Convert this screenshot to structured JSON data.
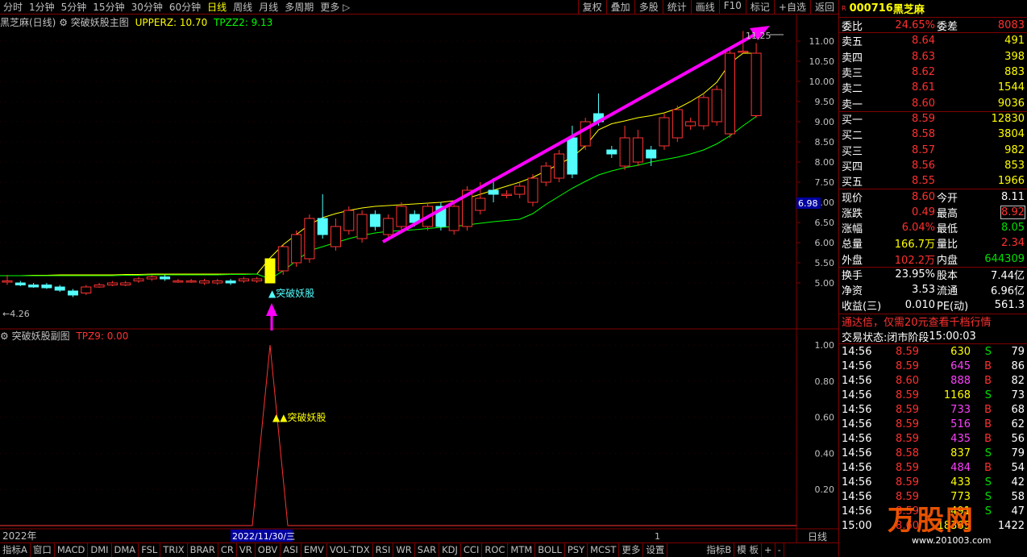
{
  "topbar": {
    "periods": [
      "分时",
      "1分钟",
      "5分钟",
      "15分钟",
      "30分钟",
      "60分钟",
      "日线",
      "周线",
      "月线",
      "多周期",
      "更多 ▷"
    ],
    "active_period": "日线",
    "tools": [
      "复权",
      "叠加",
      "多股",
      "统计",
      "画线",
      "F10",
      "标记",
      "+自选",
      "返回"
    ]
  },
  "main_chart": {
    "stock_label": "黑芝麻(日线)",
    "indicator_name": "突破妖股主图",
    "upperz_label": "UPPERZ: 10.70",
    "tpzz2_label": "TPZZ2: 9.13",
    "high_marker": "11.25",
    "low_marker": "4.26",
    "signal_label": "▲突破妖股",
    "price_tag": "6.98",
    "y_ticks": [
      "11.00",
      "10.50",
      "10.00",
      "9.50",
      "9.00",
      "8.50",
      "8.00",
      "7.50",
      "7.00",
      "6.50",
      "6.00",
      "5.50",
      "5.00"
    ]
  },
  "sub_chart": {
    "indicator_name": "突破妖股副图",
    "tpz9_label": "TPZ9: 0.00",
    "signal_label": "▲▲突破妖股",
    "y_ticks": [
      "1.00",
      "0.80",
      "0.60",
      "0.40",
      "0.20"
    ]
  },
  "x_axis": {
    "year_label": "2022年",
    "cursor_date": "2022/11/30/三",
    "marker": "1",
    "period_label": "日线"
  },
  "bottombar": {
    "items": [
      "指标A",
      "窗口",
      "MACD",
      "DMI",
      "DMA",
      "FSL",
      "TRIX",
      "BRAR",
      "CR",
      "VR",
      "OBV",
      "ASI",
      "EMV",
      "VOL-TDX",
      "RSI",
      "WR",
      "SAR",
      "KDJ",
      "CCI",
      "ROC",
      "MTM",
      "BOLL",
      "PSY",
      "MCST",
      "更多",
      "设置",
      "指标B",
      "模 板",
      "+",
      "-"
    ]
  },
  "quote": {
    "badge": "R",
    "code": "000716",
    "name": "黑芝麻",
    "weibi_label": "委比",
    "weibi": "24.65%",
    "weicha_label": "委差",
    "weicha": "8083",
    "sells": [
      {
        "label": "卖五",
        "price": "8.64",
        "vol": "491"
      },
      {
        "label": "卖四",
        "price": "8.63",
        "vol": "398"
      },
      {
        "label": "卖三",
        "price": "8.62",
        "vol": "883"
      },
      {
        "label": "卖二",
        "price": "8.61",
        "vol": "1544"
      },
      {
        "label": "卖一",
        "price": "8.60",
        "vol": "9036"
      }
    ],
    "buys": [
      {
        "label": "买一",
        "price": "8.59",
        "vol": "12830"
      },
      {
        "label": "买二",
        "price": "8.58",
        "vol": "3804"
      },
      {
        "label": "买三",
        "price": "8.57",
        "vol": "982"
      },
      {
        "label": "买四",
        "price": "8.56",
        "vol": "853"
      },
      {
        "label": "买五",
        "price": "8.55",
        "vol": "1966"
      }
    ],
    "stats": [
      {
        "l1": "现价",
        "v1": "8.60",
        "l2": "今开",
        "v2": "8.11"
      },
      {
        "l1": "涨跌",
        "v1": "0.49",
        "l2": "最高",
        "v2": "8.92"
      },
      {
        "l1": "涨幅",
        "v1": "6.04%",
        "l2": "最低",
        "v2": "8.05"
      },
      {
        "l1": "总量",
        "v1": "166.7万",
        "l2": "量比",
        "v2": "2.34"
      },
      {
        "l1": "外盘",
        "v1": "102.2万",
        "l2": "内盘",
        "v2": "644309"
      }
    ],
    "stats2": [
      {
        "l1": "换手",
        "v1": "23.95%",
        "l2": "股本",
        "v2": "7.44亿"
      },
      {
        "l1": "净资",
        "v1": "3.53",
        "l2": "流通",
        "v2": "6.96亿"
      },
      {
        "l1": "收益(三)",
        "v1": "0.010",
        "l2": "PE(动)",
        "v2": "561.3"
      }
    ],
    "ad_text": "通达信，仅需20元查看千档行情",
    "trade_status_label": "交易状态:",
    "trade_status": "闭市阶段",
    "trade_time": "15:00:03",
    "ticks": [
      {
        "t": "14:56",
        "p": "8.59",
        "v": "630",
        "s": "S",
        "n": "79"
      },
      {
        "t": "14:56",
        "p": "8.59",
        "v": "645",
        "s": "B",
        "n": "86"
      },
      {
        "t": "14:56",
        "p": "8.60",
        "v": "888",
        "s": "B",
        "n": "82"
      },
      {
        "t": "14:56",
        "p": "8.59",
        "v": "1168",
        "s": "S",
        "n": "73"
      },
      {
        "t": "14:56",
        "p": "8.59",
        "v": "733",
        "s": "B",
        "n": "68"
      },
      {
        "t": "14:56",
        "p": "8.59",
        "v": "516",
        "s": "B",
        "n": "62"
      },
      {
        "t": "14:56",
        "p": "8.59",
        "v": "435",
        "s": "B",
        "n": "56"
      },
      {
        "t": "14:56",
        "p": "8.58",
        "v": "837",
        "s": "S",
        "n": "79"
      },
      {
        "t": "14:56",
        "p": "8.59",
        "v": "484",
        "s": "B",
        "n": "54"
      },
      {
        "t": "14:56",
        "p": "8.59",
        "v": "433",
        "s": "S",
        "n": "42"
      },
      {
        "t": "14:56",
        "p": "8.59",
        "v": "773",
        "s": "S",
        "n": "58"
      },
      {
        "t": "14:56",
        "p": "8.59",
        "v": "491",
        "s": "S",
        "n": "47"
      },
      {
        "t": "15:00",
        "p": "8.60",
        "v": "18365",
        "s": "",
        "n": "1422"
      }
    ],
    "watermark": "万股网",
    "watermark_url": "www.201003.com"
  },
  "chart_data": {
    "type": "candlestick",
    "candles": [
      [
        5.05,
        5.05,
        5.2,
        4.95
      ],
      [
        5.0,
        4.95,
        5.05,
        4.92
      ],
      [
        4.95,
        4.9,
        5.0,
        4.88
      ],
      [
        4.95,
        4.88,
        5.0,
        4.85
      ],
      [
        4.9,
        4.82,
        4.95,
        4.78
      ],
      [
        4.8,
        4.7,
        4.85,
        4.65
      ],
      [
        4.75,
        4.9,
        4.95,
        4.7
      ],
      [
        4.9,
        4.95,
        5.0,
        4.88
      ],
      [
        4.95,
        5.0,
        5.05,
        4.92
      ],
      [
        4.95,
        5.0,
        5.05,
        4.92
      ],
      [
        5.05,
        5.1,
        5.15,
        5.0
      ],
      [
        5.1,
        5.15,
        5.2,
        5.05
      ],
      [
        5.15,
        5.1,
        5.2,
        5.05
      ],
      [
        5.05,
        5.05,
        5.1,
        5.0
      ],
      [
        5.05,
        5.05,
        5.1,
        5.0
      ],
      [
        5.0,
        5.05,
        5.1,
        4.95
      ],
      [
        5.0,
        5.05,
        5.1,
        4.95
      ],
      [
        5.05,
        5.0,
        5.1,
        4.95
      ],
      [
        5.05,
        5.1,
        5.15,
        5.0
      ],
      [
        5.05,
        5.1,
        5.15,
        5.0
      ],
      [
        5.0,
        5.6,
        5.6,
        5.0
      ],
      [
        5.3,
        5.9,
        5.95,
        5.2
      ],
      [
        5.5,
        6.2,
        6.3,
        5.4
      ],
      [
        5.6,
        6.6,
        6.7,
        5.5
      ],
      [
        6.6,
        6.2,
        7.2,
        6.1
      ],
      [
        5.9,
        6.4,
        6.6,
        5.8
      ],
      [
        6.3,
        6.8,
        6.9,
        6.2
      ],
      [
        6.1,
        6.7,
        6.8,
        6.0
      ],
      [
        6.7,
        6.4,
        6.8,
        6.3
      ],
      [
        6.2,
        6.6,
        6.7,
        6.1
      ],
      [
        6.4,
        6.9,
        7.0,
        6.3
      ],
      [
        6.7,
        6.5,
        6.8,
        6.4
      ],
      [
        6.4,
        6.9,
        7.0,
        6.3
      ],
      [
        6.9,
        6.4,
        7.0,
        6.3
      ],
      [
        6.3,
        6.9,
        7.0,
        6.2
      ],
      [
        6.4,
        7.3,
        7.4,
        6.3
      ],
      [
        6.8,
        7.1,
        7.5,
        6.7
      ],
      [
        7.3,
        7.2,
        7.6,
        7.0
      ],
      [
        7.2,
        7.2,
        7.3,
        7.1
      ],
      [
        7.2,
        7.4,
        7.5,
        7.1
      ],
      [
        7.0,
        7.6,
        7.7,
        6.9
      ],
      [
        7.5,
        7.9,
        8.0,
        7.4
      ],
      [
        7.6,
        8.2,
        8.3,
        7.5
      ],
      [
        8.6,
        7.7,
        8.9,
        7.6
      ],
      [
        8.4,
        9.0,
        9.1,
        8.3
      ],
      [
        9.2,
        9.0,
        9.7,
        8.9
      ],
      [
        8.3,
        8.2,
        8.4,
        8.1
      ],
      [
        7.9,
        8.6,
        8.9,
        7.8
      ],
      [
        8.0,
        8.6,
        8.8,
        7.9
      ],
      [
        8.3,
        8.1,
        8.4,
        7.9
      ],
      [
        8.4,
        9.1,
        9.2,
        8.3
      ],
      [
        8.6,
        9.3,
        9.4,
        8.5
      ],
      [
        8.9,
        9.0,
        9.1,
        8.8
      ],
      [
        8.9,
        9.6,
        9.7,
        8.8
      ],
      [
        9.0,
        9.8,
        9.9,
        8.9
      ],
      [
        8.7,
        10.7,
        10.8,
        8.6
      ],
      [
        10.75,
        10.75,
        11.25,
        10.7
      ],
      [
        9.15,
        10.7,
        10.95,
        9.1
      ]
    ],
    "upper_band": [
      5.18,
      5.18,
      5.19,
      5.19,
      5.2,
      5.2,
      5.2,
      5.2,
      5.2,
      5.21,
      5.21,
      5.22,
      5.22,
      5.22,
      5.22,
      5.22,
      5.22,
      5.22,
      5.22,
      5.22,
      5.62,
      5.95,
      6.2,
      6.45,
      6.62,
      6.72,
      6.8,
      6.86,
      6.9,
      6.92,
      6.94,
      6.96,
      6.98,
      7.0,
      7.04,
      7.1,
      7.2,
      7.3,
      7.4,
      7.5,
      7.62,
      7.78,
      7.95,
      8.12,
      8.4,
      8.8,
      8.95,
      9.02,
      9.1,
      9.15,
      9.22,
      9.33,
      9.5,
      9.7,
      9.98,
      10.45,
      10.7,
      10.7
    ],
    "lower_band": [
      5.18,
      5.18,
      5.18,
      5.18,
      5.18,
      5.18,
      5.18,
      5.18,
      5.18,
      5.19,
      5.19,
      5.2,
      5.2,
      5.2,
      5.2,
      5.2,
      5.2,
      5.21,
      5.21,
      5.22,
      5.1,
      5.3,
      5.55,
      5.8,
      5.9,
      6.0,
      6.1,
      6.18,
      6.24,
      6.28,
      6.3,
      6.32,
      6.35,
      6.38,
      6.4,
      6.44,
      6.48,
      6.52,
      6.55,
      6.58,
      6.72,
      6.95,
      7.15,
      7.35,
      7.52,
      7.68,
      7.78,
      7.86,
      7.92,
      8.0,
      8.06,
      8.12,
      8.2,
      8.3,
      8.45,
      8.65,
      8.9,
      9.13
    ],
    "signal_index": 20,
    "sub_values": [
      0,
      0,
      0,
      0,
      0,
      0,
      0,
      0,
      0,
      0,
      0,
      0,
      0,
      0,
      0,
      0,
      0,
      0,
      0,
      0,
      1,
      0,
      0,
      0,
      0,
      0,
      0,
      0,
      0,
      0,
      0,
      0,
      0,
      0,
      0,
      0,
      0,
      0,
      0,
      0,
      0,
      0,
      0,
      0,
      0,
      0,
      0,
      0,
      0,
      0,
      0,
      0,
      0,
      0,
      0,
      0,
      0,
      0
    ],
    "ylim_main": [
      4.2,
      11.5
    ],
    "ylim_sub": [
      0,
      1.1
    ],
    "colors": {
      "up": "#ff3232",
      "down": "#54fcfc",
      "upper": "#ffff00",
      "lower": "#00ff00",
      "arrow": "#ff00ff",
      "signal": "#ffff00"
    }
  }
}
